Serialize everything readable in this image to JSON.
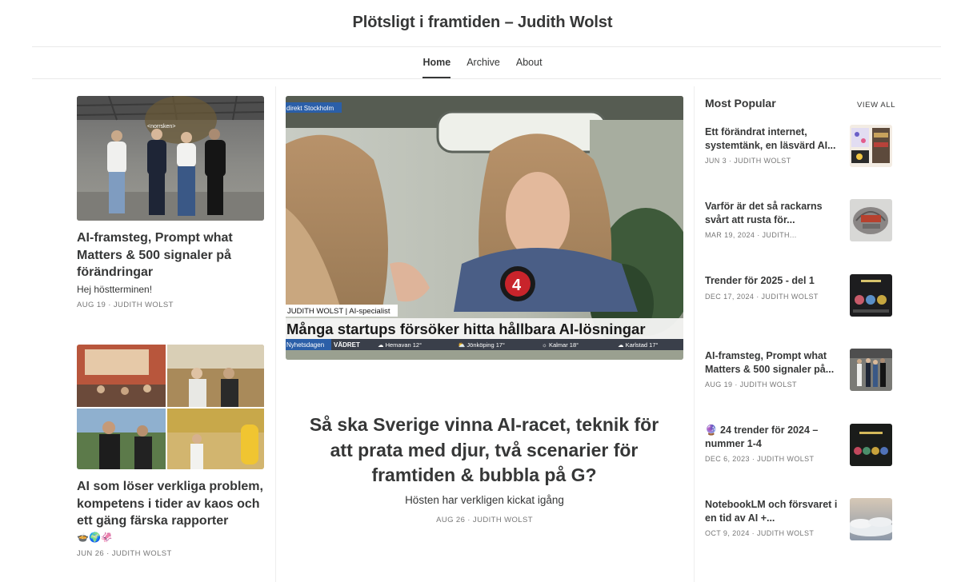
{
  "site": {
    "title": "Plötsligt i framtiden – Judith Wolst"
  },
  "nav": {
    "home": "Home",
    "archive": "Archive",
    "about": "About"
  },
  "left_posts": [
    {
      "title": "AI-framsteg, Prompt what Matters & 500 signaler på förändringar",
      "subtitle": "Hej höstterminen!",
      "meta": "AUG 19 · JUDITH WOLST",
      "image_sign": "<norrsken>"
    },
    {
      "title": "AI som löser verkliga problem, kompetens i tider av kaos och ett gäng färska rapporter",
      "subtitle": "🍲🌍🦑",
      "meta": "JUN 26 · JUDITH WOLST"
    }
  ],
  "hero": {
    "tv_tag": "direkt Stockholm",
    "tv_name": "JUDITH WOLST | AI-specialist",
    "tv_headline": "Många startups försöker hitta hållbara AI-lösningar",
    "tv_ticker_label": "Nyhetsdagen",
    "tv_ticker_weather": "VÄDRET",
    "tv_ticker_items": [
      "☁ Hemavan 12°",
      "⛅ Jönköping 17°",
      "☼ Kalmar 18°",
      "☁ Karlstad 17°"
    ],
    "tv_logo": "4",
    "title": "Så ska Sverige vinna AI-racet, teknik för att prata med djur, två scenarier för framtiden & bubbla på G?",
    "subtitle": "Hösten har verkligen kickat igång",
    "meta": "AUG 26 · JUDITH WOLST"
  },
  "popular": {
    "heading": "Most Popular",
    "view_all": "VIEW ALL",
    "items": [
      {
        "title": "Ett förändrat internet, systemtänk, en läsvärd AI...",
        "meta": "JUN 3 · JUDITH WOLST"
      },
      {
        "title": "Varför är det så rackarns svårt att rusta för...",
        "meta": "MAR 19, 2024 · JUDITH..."
      },
      {
        "title": "Trender för 2025 - del 1",
        "meta": "DEC 17, 2024 · JUDITH WOLST"
      },
      {
        "title": "AI-framsteg, Prompt what Matters & 500 signaler på...",
        "meta": "AUG 19 · JUDITH WOLST"
      },
      {
        "title": "🔮 24 trender för 2024 – nummer 1-4",
        "meta": "DEC 6, 2023 · JUDITH WOLST"
      },
      {
        "title": "NotebookLM och försvaret i en tid av AI +...",
        "meta": "OCT 9, 2024 · JUDITH WOLST"
      }
    ]
  }
}
